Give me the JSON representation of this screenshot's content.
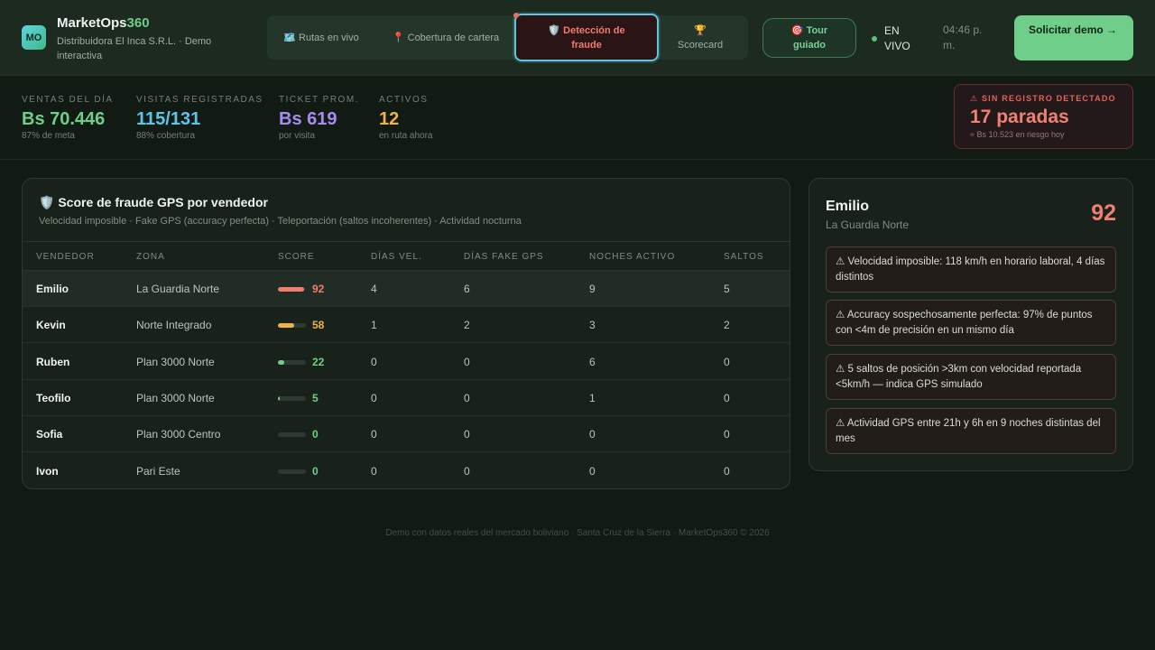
{
  "brand": {
    "logo_text": "MO",
    "name_main": "MarketOps",
    "name_accent": "360",
    "subtitle": "Distribuidora El Inca S.R.L. · Demo interactiva"
  },
  "tabs": [
    {
      "icon": "🗺️",
      "label": "Rutas en vivo",
      "active": false
    },
    {
      "icon": "📍",
      "label": "Cobertura de cartera",
      "active": false
    },
    {
      "icon": "🛡️",
      "label": "Detección de fraude",
      "active": true
    },
    {
      "icon": "🏆",
      "label": "Scorecard",
      "active": false
    }
  ],
  "header": {
    "tour_icon": "🎯",
    "tour_label": "Tour guiado",
    "live_label": "EN VIVO",
    "clock": "04:46 p. m.",
    "demo_label": "Solicitar demo →"
  },
  "kpis": [
    {
      "label": "VENTAS DEL DÍA",
      "value": "Bs 70.446",
      "sub": "87% de meta",
      "color": "#6fcf8a"
    },
    {
      "label": "VISITAS REGISTRADAS",
      "value": "115/131",
      "sub": "88% cobertura",
      "color": "#5cc6ea"
    },
    {
      "label": "TICKET PROM.",
      "value": "Bs 619",
      "sub": "por visita",
      "color": "#a98bf0"
    },
    {
      "label": "ACTIVOS",
      "value": "12",
      "sub": "en ruta ahora",
      "color": "#f0b04c"
    }
  ],
  "alert": {
    "icon": "⚠",
    "label": "SIN REGISTRO DETECTADO",
    "value": "17 paradas",
    "sub": "≈ Bs 10.523 en riesgo hoy"
  },
  "fraud_panel": {
    "icon": "🛡️",
    "title": "Score de fraude GPS por vendedor",
    "subtitle": "Velocidad imposible · Fake GPS (accuracy perfecta) · Teleportación (saltos incoherentes) · Actividad nocturna",
    "columns": [
      "VENDEDOR",
      "ZONA",
      "SCORE",
      "DÍAS VEL.",
      "DÍAS FAKE GPS",
      "NOCHES ACTIVO",
      "SALTOS"
    ],
    "rows": [
      {
        "name": "Emilio",
        "zone": "La Guardia Norte",
        "score": "92",
        "score_frac": 0.92,
        "color": "#ef7f6f",
        "dias_vel": "4",
        "fake_gps": "6",
        "noches": "9",
        "saltos": "5",
        "selected": true
      },
      {
        "name": "Kevin",
        "zone": "Norte Integrado",
        "score": "58",
        "score_frac": 0.58,
        "color": "#f0b04c",
        "dias_vel": "1",
        "fake_gps": "2",
        "noches": "3",
        "saltos": "2",
        "selected": false
      },
      {
        "name": "Ruben",
        "zone": "Plan 3000 Norte",
        "score": "22",
        "score_frac": 0.22,
        "color": "#6fcf8a",
        "dias_vel": "0",
        "fake_gps": "0",
        "noches": "6",
        "saltos": "0",
        "selected": false
      },
      {
        "name": "Teofilo",
        "zone": "Plan 3000 Norte",
        "score": "5",
        "score_frac": 0.05,
        "color": "#6fcf8a",
        "dias_vel": "0",
        "fake_gps": "0",
        "noches": "1",
        "saltos": "0",
        "selected": false
      },
      {
        "name": "Sofia",
        "zone": "Plan 3000 Centro",
        "score": "0",
        "score_frac": 0,
        "color": "#6fcf8a",
        "dias_vel": "0",
        "fake_gps": "0",
        "noches": "0",
        "saltos": "0",
        "selected": false
      },
      {
        "name": "Ivon",
        "zone": "Pari Este",
        "score": "0",
        "score_frac": 0,
        "color": "#6fcf8a",
        "dias_vel": "0",
        "fake_gps": "0",
        "noches": "0",
        "saltos": "0",
        "selected": false
      }
    ]
  },
  "detail": {
    "name": "Emilio",
    "zone": "La Guardia Norte",
    "score": "92",
    "flags": [
      "⚠ Velocidad imposible: 118 km/h en horario laboral, 4 días distintos",
      "⚠ Accuracy sospechosamente perfecta: 97% de puntos con <4m de precisión en un mismo día",
      "⚠ 5 saltos de posición >3km con velocidad reportada <5km/h — indica GPS simulado",
      "⚠ Actividad GPS entre 21h y 6h en 9 noches distintas del mes"
    ]
  },
  "footer": "Demo con datos reales del mercado boliviano · Santa Cruz de la Sierra · MarketOps360 © 2026"
}
